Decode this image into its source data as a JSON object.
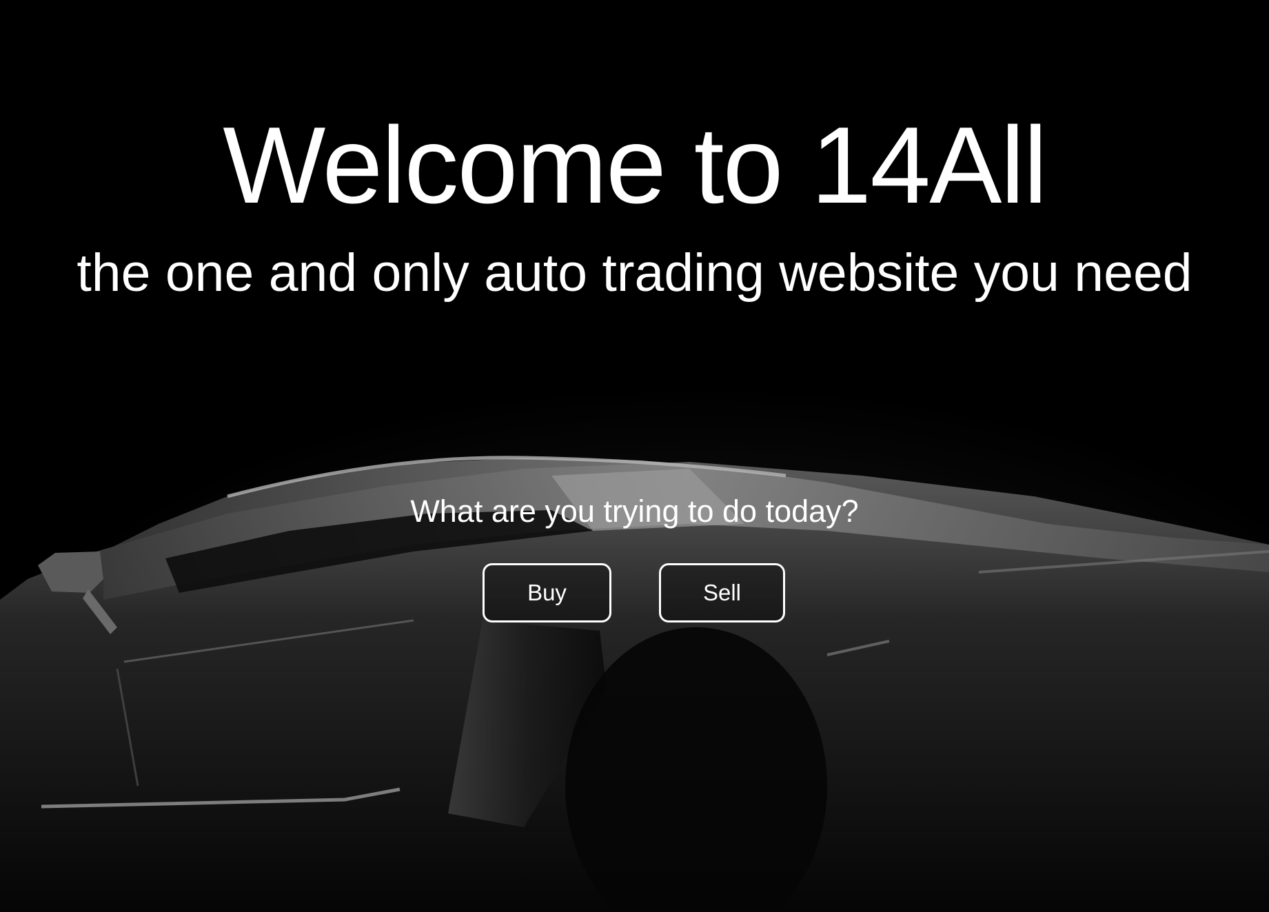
{
  "hero": {
    "title": "Welcome to 14All",
    "subtitle": "the one and only auto trading website you need",
    "background_image": "car-silhouette-image"
  },
  "actions": {
    "prompt": "What are you trying to do today?",
    "buy_label": "Buy",
    "sell_label": "Sell"
  },
  "colors": {
    "background": "#000000",
    "text": "#ffffff",
    "button_border": "#ffffff"
  }
}
